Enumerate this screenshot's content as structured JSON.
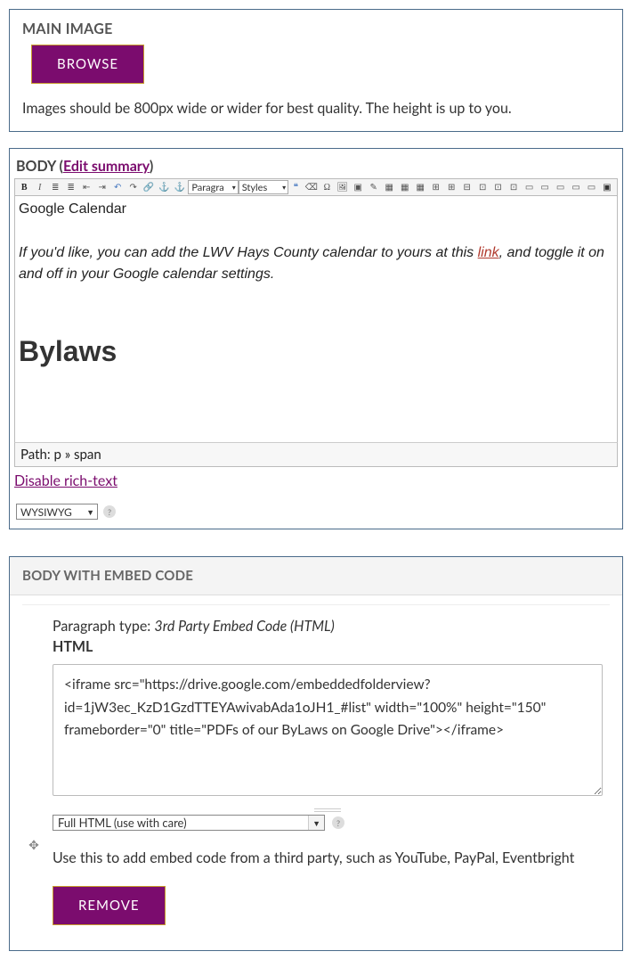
{
  "main_image": {
    "label": "MAIN IMAGE",
    "browse": "BROWSE",
    "help": "Images should be 800px wide or wider for best quality. The height is up to you."
  },
  "body": {
    "label": "BODY",
    "paren_open": " (",
    "edit_summary": "Edit summary",
    "paren_close": ")",
    "toolbar": {
      "paragraph": "Paragra",
      "styles": "Styles",
      "quote": "❝",
      "omega": "Ω"
    },
    "content": {
      "line1": "Google Calendar",
      "line2a": "If you'd like, you can add the LWV Hays County calendar to yours at this ",
      "link": "link",
      "line2b": ", and toggle it on and off in your Google calendar settings.",
      "h": "Bylaws"
    },
    "path": "Path: p » span",
    "disable": "Disable rich-text",
    "format_select": "WYSIWYG"
  },
  "embed": {
    "header": "BODY WITH EMBED CODE",
    "ptype_label": "Paragraph type: ",
    "ptype_value": "3rd Party Embed Code (HTML)",
    "html_label": "HTML",
    "code": "<iframe src=\"https://drive.google.com/embeddedfolderview?id=1jW3ec_KzD1GzdTTEYAwivabAda1oJH1_#list\" width=\"100%\" height=\"150\" frameborder=\"0\" title=\"PDFs of our ByLaws on Google Drive\"></iframe>",
    "format_select": "Full HTML (use with care)",
    "help": "Use this to add embed code from a third party, such as YouTube, PayPal, Eventbright",
    "remove": "REMOVE"
  }
}
